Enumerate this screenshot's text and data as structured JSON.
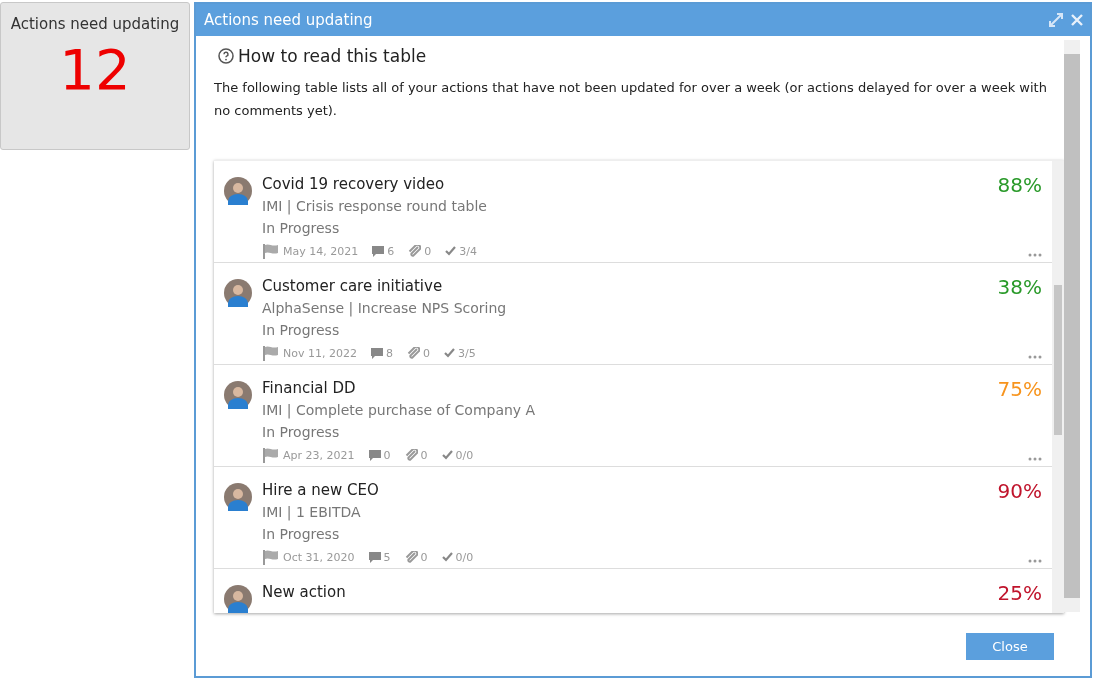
{
  "tile": {
    "title": "Actions need updating",
    "count": "12"
  },
  "dialog": {
    "title": "Actions need updating",
    "help_heading": "How to read this table",
    "help_text": "The following table lists all of your actions that have not been updated for over a week (or actions delayed for over a week with no comments yet).",
    "actions": [
      {
        "title": "Covid 19 recovery video",
        "subtitle": "IMI | Crisis response round table",
        "status": "In Progress",
        "percent": "88%",
        "color": "#2a9a2a",
        "due": "May 14, 2021",
        "comments": "6",
        "attachments": "0",
        "checklist": "3/4"
      },
      {
        "title": "Customer care initiative",
        "subtitle": "AlphaSense | Increase NPS Scoring",
        "status": "In Progress",
        "percent": "38%",
        "color": "#2a9a2a",
        "due": "Nov 11, 2022",
        "comments": "8",
        "attachments": "0",
        "checklist": "3/5"
      },
      {
        "title": "Financial DD",
        "subtitle": "IMI | Complete purchase of Company A",
        "status": "In Progress",
        "percent": "75%",
        "color": "#f7941d",
        "due": "Apr 23, 2021",
        "comments": "0",
        "attachments": "0",
        "checklist": "0/0"
      },
      {
        "title": "Hire a new CEO",
        "subtitle": "IMI | 1 EBITDA",
        "status": "In Progress",
        "percent": "90%",
        "color": "#c0142c",
        "due": "Oct 31, 2020",
        "comments": "5",
        "attachments": "0",
        "checklist": "0/0"
      },
      {
        "title": "New action",
        "percent": "25%",
        "color": "#c0142c"
      }
    ],
    "close_button": "Close"
  }
}
